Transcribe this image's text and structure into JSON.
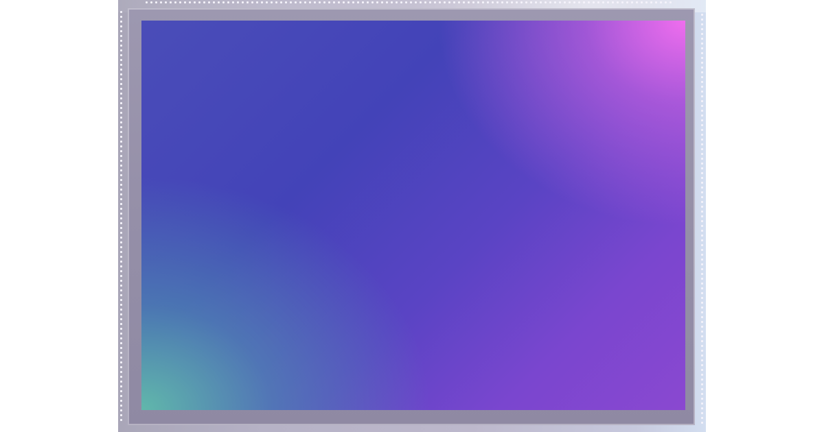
{
  "scene": {
    "subject": "image-sensor-chip",
    "colors": {
      "background": "#ffffff",
      "package": "#b6b2c6",
      "bezel": "#958fa8",
      "sensor_magenta": "#f770f0",
      "sensor_indigo": "#4343b8",
      "sensor_teal": "#62beaa"
    }
  }
}
